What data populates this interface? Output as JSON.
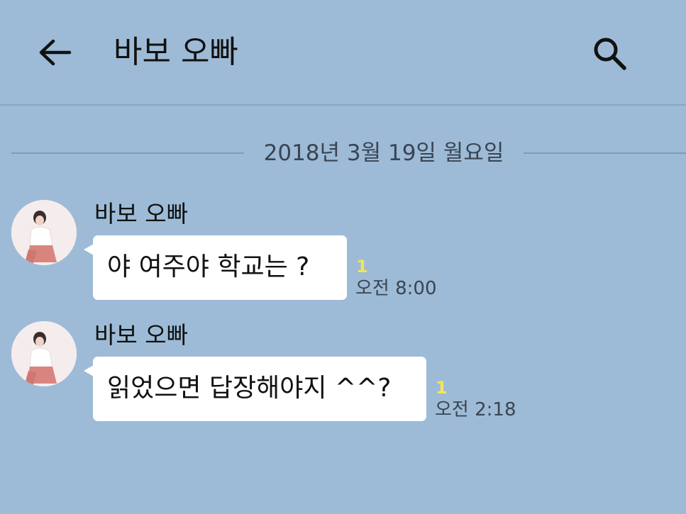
{
  "header": {
    "back_icon": "arrow-left-icon",
    "title": "바보 오빠",
    "search_icon": "search-icon"
  },
  "date_separator": "2018년 3월 19일 월요일",
  "messages": [
    {
      "sender": "바보 오빠",
      "text": "야 여주야 학교는 ?",
      "unread": "1",
      "time": "오전 8:00"
    },
    {
      "sender": "바보 오빠",
      "text": "읽었으면 답장해야지 ^^?",
      "unread": "1",
      "time": "오전 2:18"
    }
  ],
  "colors": {
    "background": "#9dbbd6",
    "bubble": "#ffffff",
    "unread": "#f4e45a",
    "divider": "#86a6c2"
  }
}
